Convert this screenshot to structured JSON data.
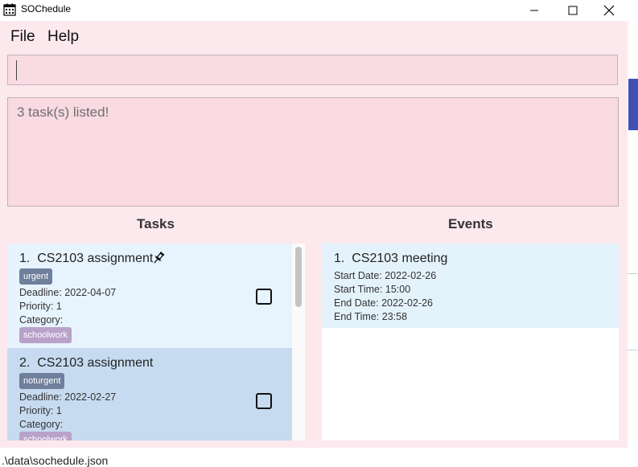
{
  "window": {
    "title": "SOChedule",
    "icon": "calendar-icon"
  },
  "menu": {
    "file": "File",
    "help": "Help"
  },
  "command": {
    "value": ""
  },
  "result": {
    "text": "3 task(s) listed!"
  },
  "tasks": {
    "title": "Tasks",
    "items": [
      {
        "index": "1.",
        "name": "CS2103 assignment",
        "pinned": true,
        "priority_tag": "urgent",
        "deadline": "Deadline: 2022-04-07",
        "priority": "Priority: 1",
        "category_label": "Category:",
        "category_tag": "schoolwork",
        "completed": false
      },
      {
        "index": "2.",
        "name": "CS2103 assignment",
        "pinned": false,
        "priority_tag": "noturgent",
        "deadline": "Deadline: 2022-02-27",
        "priority": "Priority: 1",
        "category_label": "Category:",
        "category_tag": "schoolwork",
        "completed": false
      }
    ]
  },
  "events": {
    "title": "Events",
    "items": [
      {
        "index": "1.",
        "name": "CS2103 meeting",
        "start_date": "Start Date: 2022-02-26",
        "start_time": "Start Time: 15:00",
        "end_date": "End Date: 2022-02-26",
        "end_time": "End Time: 23:58"
      }
    ]
  },
  "status": {
    "path": ".\\data\\sochedule.json"
  },
  "colors": {
    "accent": "#3f51b5",
    "window_bg": "#fbe9ee",
    "task_card_1": "#e7f3fd",
    "task_card_2": "#c6dbf0"
  }
}
